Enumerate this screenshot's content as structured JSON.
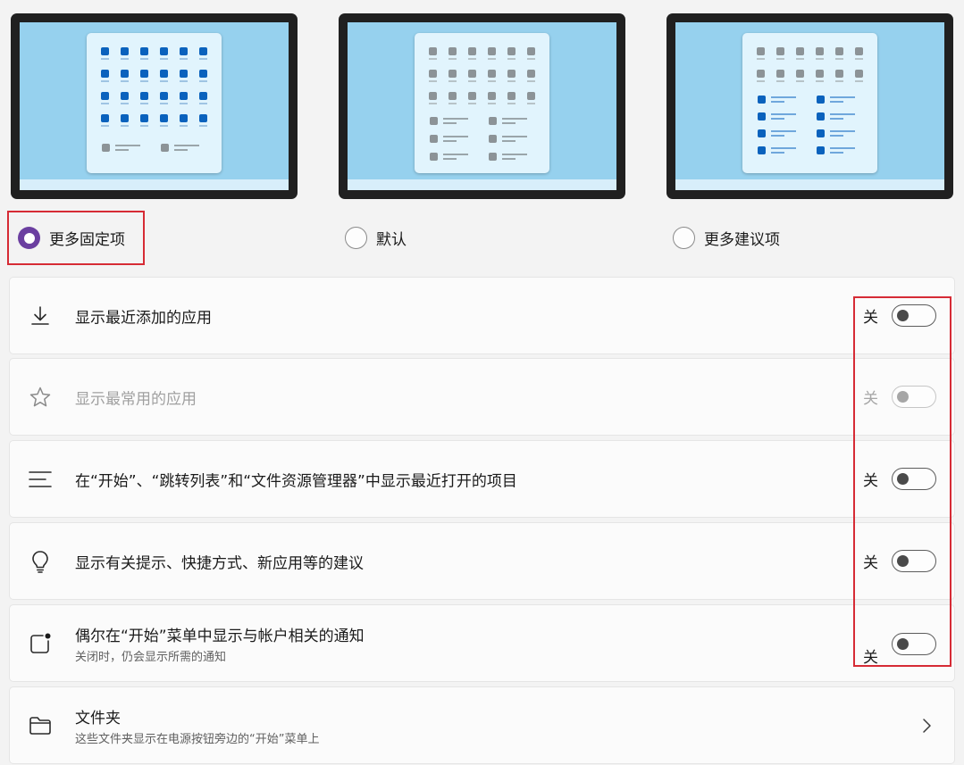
{
  "layout_options": [
    {
      "label": "更多固定项",
      "checked": true
    },
    {
      "label": "默认",
      "checked": false
    },
    {
      "label": "更多建议项",
      "checked": false
    }
  ],
  "settings": [
    {
      "title": "显示最近添加的应用",
      "state": "关",
      "icon": "download-icon",
      "disabled": false
    },
    {
      "title": "显示最常用的应用",
      "state": "关",
      "icon": "star-icon",
      "disabled": true
    },
    {
      "title": "在“开始”、“跳转列表”和“文件资源管理器”中显示最近打开的项目",
      "state": "关",
      "icon": "list-icon",
      "disabled": false
    },
    {
      "title": "显示有关提示、快捷方式、新应用等的建议",
      "state": "关",
      "icon": "lightbulb-icon",
      "disabled": false
    },
    {
      "title": "偶尔在“开始”菜单中显示与帐户相关的通知",
      "subtitle": "关闭时，仍会显示所需的通知",
      "state": "关",
      "icon": "notification-icon",
      "disabled": false
    }
  ],
  "folders": {
    "title": "文件夹",
    "subtitle": "这些文件夹显示在电源按钮旁边的“开始”菜单上",
    "icon": "folder-icon"
  },
  "colors": {
    "accent": "#6b3fa0",
    "highlight": "#d62b35",
    "pin_blue": "#0a62bd",
    "pin_gray": "#8c9397",
    "wallpaper": "#96d1ee"
  }
}
